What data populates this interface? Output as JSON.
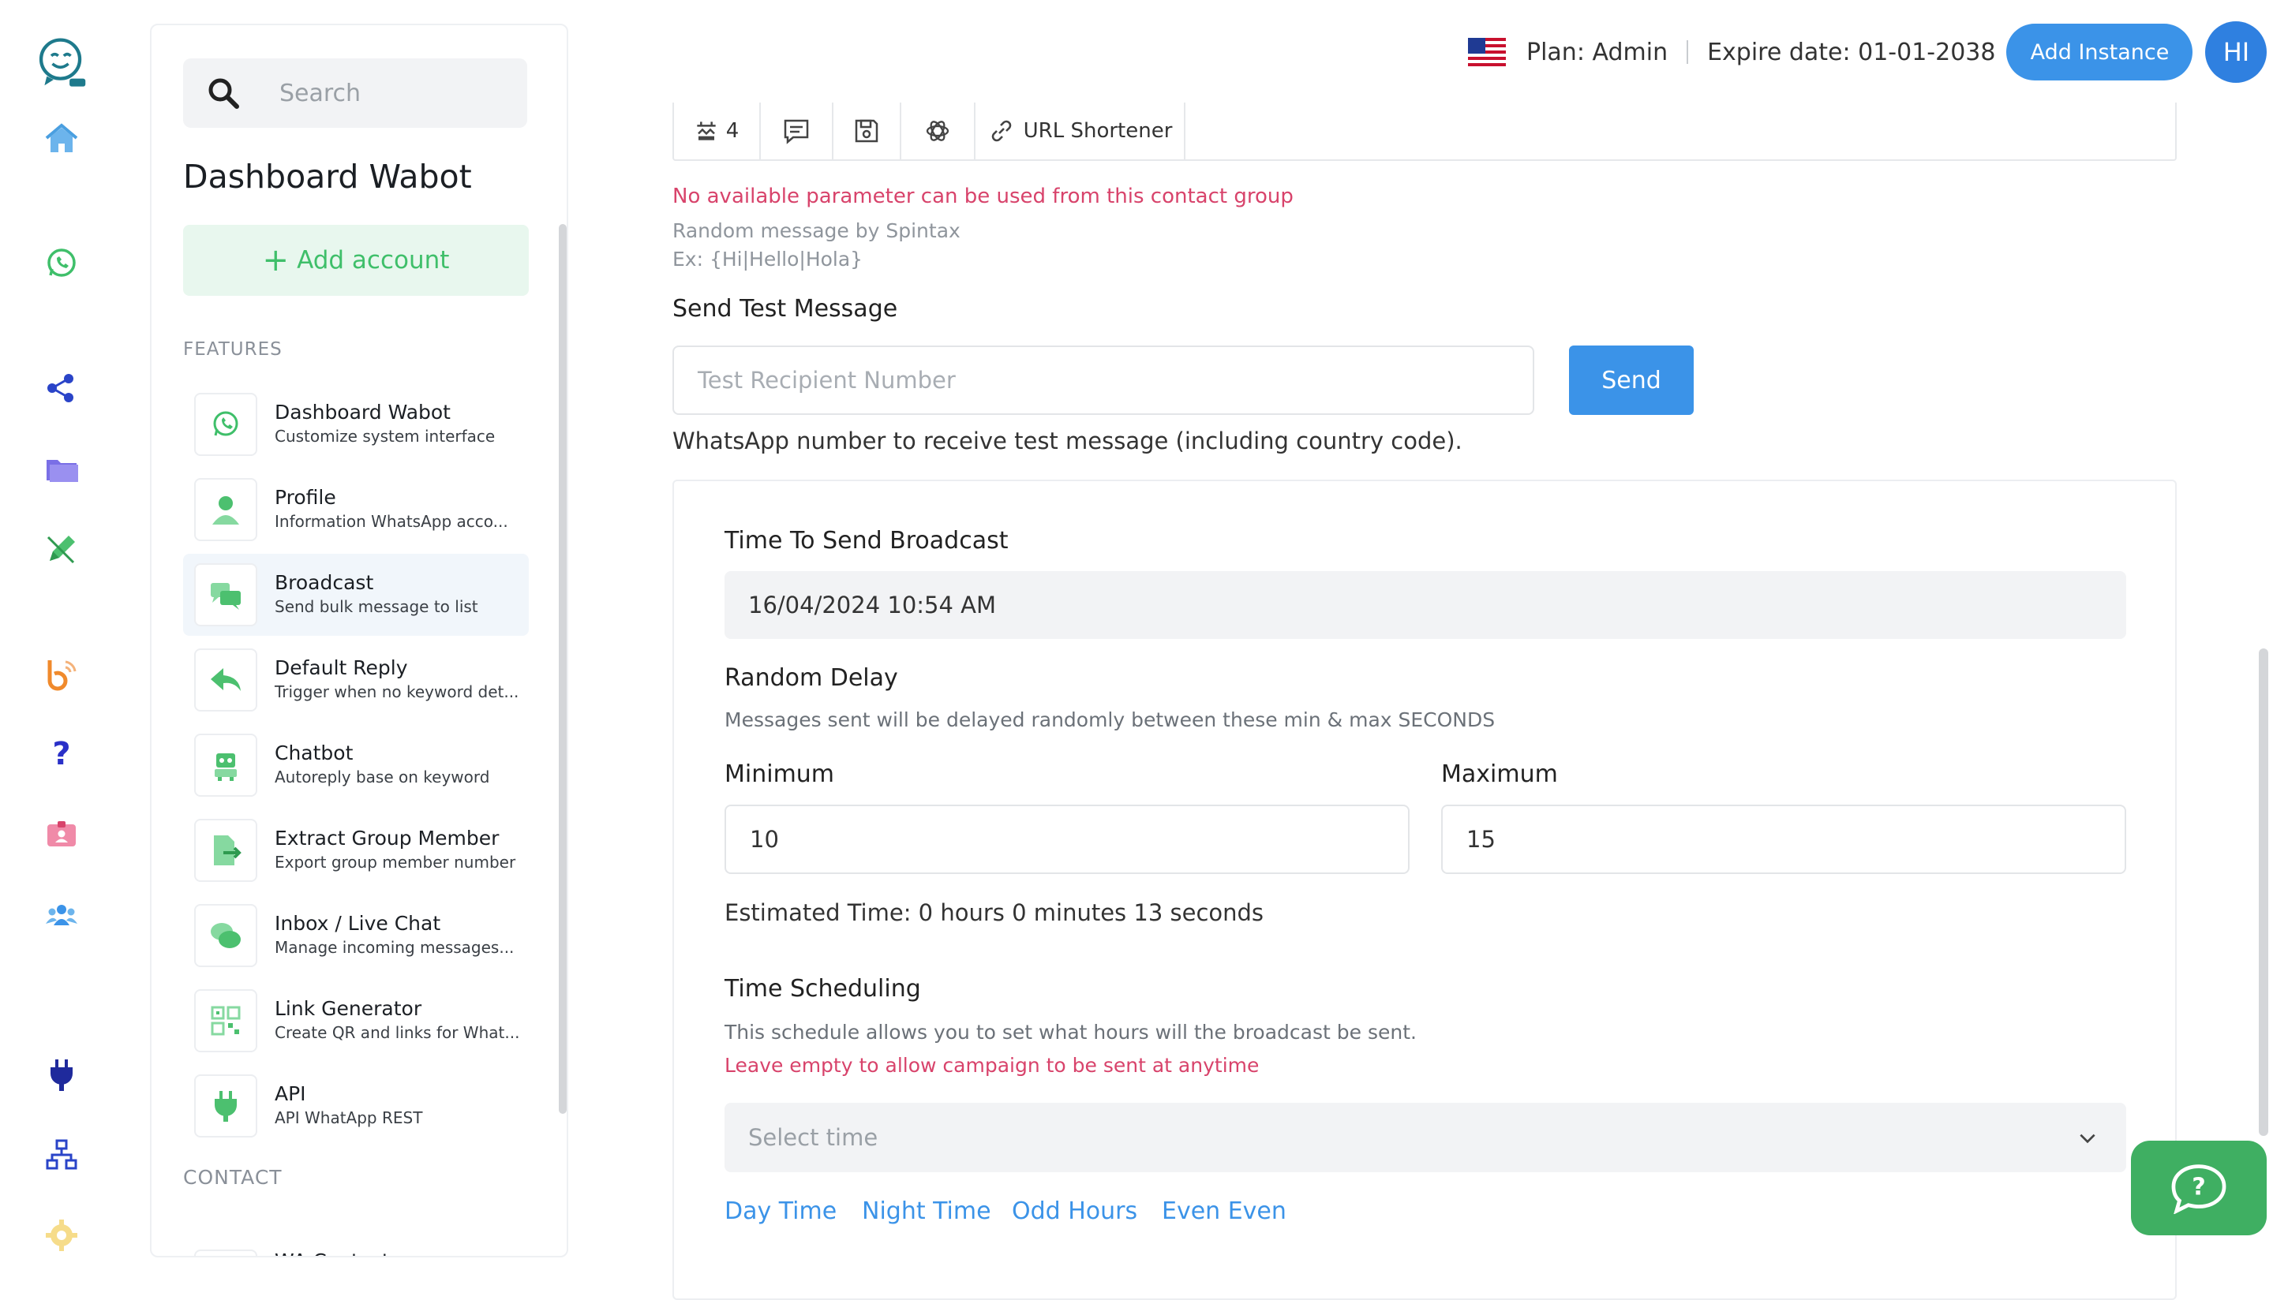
{
  "rail": {
    "icons": [
      "logo-icon",
      "home-icon",
      "whatsapp-icon",
      "share-icon",
      "folder-icon",
      "pencil-icon",
      "blogger-icon",
      "help-icon",
      "id-card-icon",
      "users-icon",
      "plug-icon",
      "network-icon",
      "settings-icon"
    ]
  },
  "sidebar": {
    "search_placeholder": "Search",
    "title": "Dashboard Wabot",
    "add_account": "Add account",
    "features_label": "FEATURES",
    "items": [
      {
        "title": "Dashboard Wabot",
        "subtitle": "Customize system interface",
        "icon": "whatsapp-icon"
      },
      {
        "title": "Profile",
        "subtitle": "Information WhatsApp acco...",
        "icon": "user-icon"
      },
      {
        "title": "Broadcast",
        "subtitle": "Send bulk message to list",
        "icon": "chat-bubbles-icon"
      },
      {
        "title": "Default Reply",
        "subtitle": "Trigger when no keyword det...",
        "icon": "reply-icon"
      },
      {
        "title": "Chatbot",
        "subtitle": "Autoreply base on keyword",
        "icon": "robot-icon"
      },
      {
        "title": "Extract Group Member",
        "subtitle": "Export group member number",
        "icon": "export-icon"
      },
      {
        "title": "Inbox / Live Chat",
        "subtitle": "Manage incoming messages...",
        "icon": "inbox-chat-icon"
      },
      {
        "title": "Link Generator",
        "subtitle": "Create QR and links for What...",
        "icon": "qr-code-icon"
      },
      {
        "title": "API",
        "subtitle": "API WhatApp REST",
        "icon": "plug-icon"
      }
    ],
    "contact_label": "CONTACT",
    "contact_items": [
      {
        "title": "WA Contacts"
      }
    ]
  },
  "topbar": {
    "plan": "Plan: Admin",
    "expire": "Expire date: 01-01-2038",
    "add_instance": "Add Instance",
    "avatar_initials": "HI"
  },
  "toolbar": {
    "count": "4",
    "url_shortener": "URL Shortener"
  },
  "message": {
    "param_error": "No available parameter can be used from this contact group",
    "spintax_hint": "Random message by Spintax",
    "spintax_example": "Ex: {Hi|Hello|Hola}"
  },
  "test": {
    "label": "Send Test Message",
    "placeholder": "Test Recipient Number",
    "send": "Send",
    "help": "WhatsApp number to receive test message (including country code)."
  },
  "broadcast": {
    "time_label": "Time To Send Broadcast",
    "time_value": "16/04/2024 10:54 AM",
    "delay_label": "Random Delay",
    "delay_hint": "Messages sent will be delayed randomly between these min & max SECONDS",
    "min_label": "Minimum",
    "min_value": "10",
    "max_label": "Maximum",
    "max_value": "15",
    "estimated": "Estimated Time: 0 hours 0 minutes 13 seconds",
    "sched_label": "Time Scheduling",
    "sched_hint": "This schedule allows you to set what hours will the broadcast be sent.",
    "sched_warn": "Leave empty to allow campaign to be sent at anytime",
    "select_placeholder": "Select time",
    "presets": [
      "Day Time",
      "Night Time",
      "Odd Hours",
      "Even Even"
    ]
  }
}
